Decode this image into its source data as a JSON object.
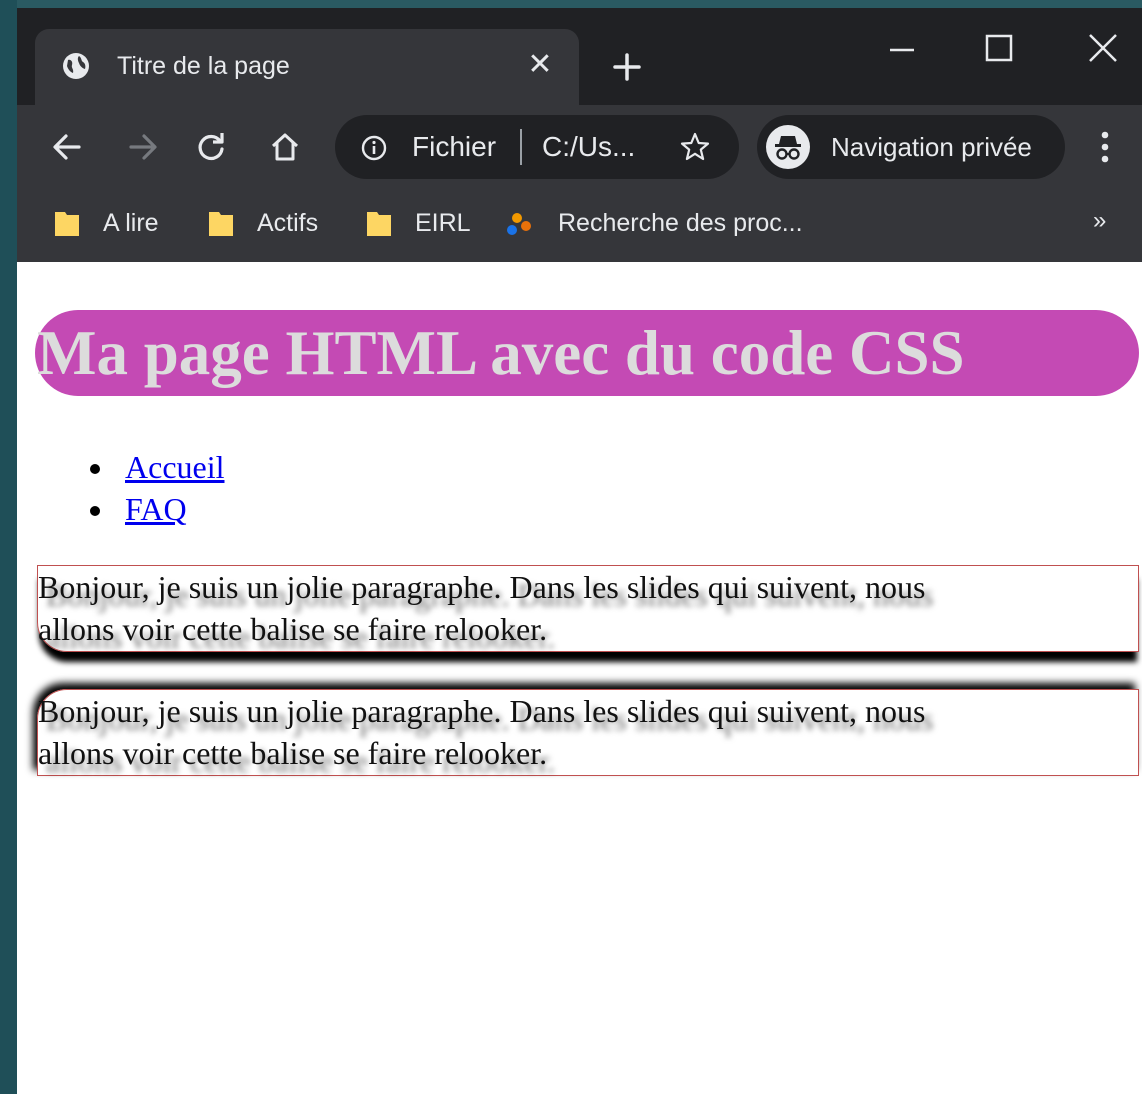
{
  "tab": {
    "title": "Titre de la page",
    "close_label": "✕"
  },
  "window_controls": {
    "minimize": "minimize-icon",
    "maximize": "maximize-icon",
    "close": "close-icon"
  },
  "omnibox": {
    "scheme_label": "Fichier",
    "url": "C:/Us..."
  },
  "incognito": {
    "label": "Navigation privée"
  },
  "bookmarks": [
    {
      "label": "A lire",
      "icon": "folder-icon"
    },
    {
      "label": "Actifs",
      "icon": "folder-icon"
    },
    {
      "label": "EIRL",
      "icon": "folder-icon"
    },
    {
      "label": "Recherche des proc...",
      "icon": "site-favicon"
    }
  ],
  "bookmarks_more": "»",
  "page": {
    "heading": "Ma page HTML avec du code CSS",
    "nav": [
      "Accueil",
      "FAQ"
    ],
    "paragraphs": [
      {
        "line1": "Bonjour, je suis un jolie paragraphe. Dans les slides qui suivent, nous",
        "line2": "allons voir cette balise se faire relooker."
      },
      {
        "line1": "Bonjour, je suis un jolie paragraphe. Dans les slides qui suivent, nous",
        "line2": "allons voir cette balise se faire relooker."
      }
    ]
  },
  "colors": {
    "chrome_dark": "#202124",
    "chrome_toolbar": "#35363a",
    "heading_bg": "#c44ab4",
    "heading_text": "#dcdcdc",
    "link": "#0000ee",
    "para_border": "#c05050",
    "desktop": "#1f4f58"
  }
}
